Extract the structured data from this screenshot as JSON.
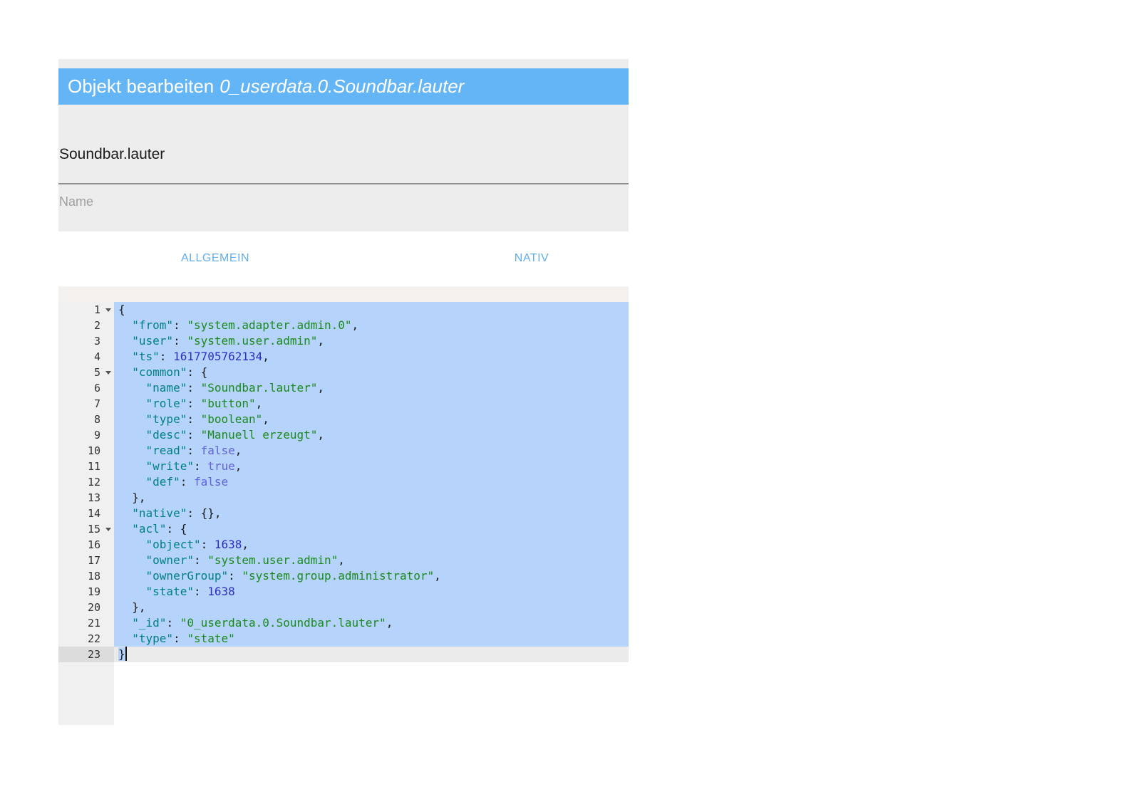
{
  "dialog": {
    "header": {
      "title_prefix": "Objekt bearbeiten",
      "object_id": "0_userdata.0.Soundbar.lauter"
    },
    "id_section": {
      "value": "Soundbar.lauter",
      "name_placeholder": "Name"
    },
    "tabs": [
      {
        "label": "ALLGEMEIN"
      },
      {
        "label": "NATIV"
      }
    ]
  },
  "colors": {
    "header-bg": "#64b5f6",
    "panel-bg": "#ededed",
    "tab-text": "#64aee8",
    "selection": "#b5d3fb",
    "gutter-bg": "#f0f0f0",
    "active-line": "#ebebeb",
    "active-gutter": "#dcdcdc",
    "tok-key": "#008080",
    "tok-string": "#1a8a1a",
    "tok-number": "#2e2ec0",
    "tok-boolean": "#6262d9"
  },
  "editor": {
    "lines": [
      {
        "n": 1,
        "fold": true,
        "sel": true,
        "tokens": [
          [
            "p",
            "{"
          ]
        ]
      },
      {
        "n": 2,
        "sel": true,
        "tokens": [
          [
            "p",
            "  "
          ],
          [
            "k",
            "\"from\""
          ],
          [
            "p",
            ": "
          ],
          [
            "s",
            "\"system.adapter.admin.0\""
          ],
          [
            "p",
            ","
          ]
        ]
      },
      {
        "n": 3,
        "sel": true,
        "tokens": [
          [
            "p",
            "  "
          ],
          [
            "k",
            "\"user\""
          ],
          [
            "p",
            ": "
          ],
          [
            "s",
            "\"system.user.admin\""
          ],
          [
            "p",
            ","
          ]
        ]
      },
      {
        "n": 4,
        "sel": true,
        "tokens": [
          [
            "p",
            "  "
          ],
          [
            "k",
            "\"ts\""
          ],
          [
            "p",
            ": "
          ],
          [
            "n",
            "1617705762134"
          ],
          [
            "p",
            ","
          ]
        ]
      },
      {
        "n": 5,
        "fold": true,
        "sel": true,
        "tokens": [
          [
            "p",
            "  "
          ],
          [
            "k",
            "\"common\""
          ],
          [
            "p",
            ": {"
          ]
        ]
      },
      {
        "n": 6,
        "sel": true,
        "tokens": [
          [
            "p",
            "    "
          ],
          [
            "k",
            "\"name\""
          ],
          [
            "p",
            ": "
          ],
          [
            "s",
            "\"Soundbar.lauter\""
          ],
          [
            "p",
            ","
          ]
        ]
      },
      {
        "n": 7,
        "sel": true,
        "tokens": [
          [
            "p",
            "    "
          ],
          [
            "k",
            "\"role\""
          ],
          [
            "p",
            ": "
          ],
          [
            "s",
            "\"button\""
          ],
          [
            "p",
            ","
          ]
        ]
      },
      {
        "n": 8,
        "sel": true,
        "tokens": [
          [
            "p",
            "    "
          ],
          [
            "k",
            "\"type\""
          ],
          [
            "p",
            ": "
          ],
          [
            "s",
            "\"boolean\""
          ],
          [
            "p",
            ","
          ]
        ]
      },
      {
        "n": 9,
        "sel": true,
        "tokens": [
          [
            "p",
            "    "
          ],
          [
            "k",
            "\"desc\""
          ],
          [
            "p",
            ": "
          ],
          [
            "s",
            "\"Manuell erzeugt\""
          ],
          [
            "p",
            ","
          ]
        ]
      },
      {
        "n": 10,
        "sel": true,
        "tokens": [
          [
            "p",
            "    "
          ],
          [
            "k",
            "\"read\""
          ],
          [
            "p",
            ": "
          ],
          [
            "b",
            "false"
          ],
          [
            "p",
            ","
          ]
        ]
      },
      {
        "n": 11,
        "sel": true,
        "tokens": [
          [
            "p",
            "    "
          ],
          [
            "k",
            "\"write\""
          ],
          [
            "p",
            ": "
          ],
          [
            "b",
            "true"
          ],
          [
            "p",
            ","
          ]
        ]
      },
      {
        "n": 12,
        "sel": true,
        "tokens": [
          [
            "p",
            "    "
          ],
          [
            "k",
            "\"def\""
          ],
          [
            "p",
            ": "
          ],
          [
            "b",
            "false"
          ]
        ]
      },
      {
        "n": 13,
        "sel": true,
        "tokens": [
          [
            "p",
            "  },"
          ]
        ]
      },
      {
        "n": 14,
        "sel": true,
        "tokens": [
          [
            "p",
            "  "
          ],
          [
            "k",
            "\"native\""
          ],
          [
            "p",
            ": {},"
          ]
        ]
      },
      {
        "n": 15,
        "fold": true,
        "sel": true,
        "tokens": [
          [
            "p",
            "  "
          ],
          [
            "k",
            "\"acl\""
          ],
          [
            "p",
            ": {"
          ]
        ]
      },
      {
        "n": 16,
        "sel": true,
        "tokens": [
          [
            "p",
            "    "
          ],
          [
            "k",
            "\"object\""
          ],
          [
            "p",
            ": "
          ],
          [
            "n",
            "1638"
          ],
          [
            "p",
            ","
          ]
        ]
      },
      {
        "n": 17,
        "sel": true,
        "tokens": [
          [
            "p",
            "    "
          ],
          [
            "k",
            "\"owner\""
          ],
          [
            "p",
            ": "
          ],
          [
            "s",
            "\"system.user.admin\""
          ],
          [
            "p",
            ","
          ]
        ]
      },
      {
        "n": 18,
        "sel": true,
        "tokens": [
          [
            "p",
            "    "
          ],
          [
            "k",
            "\"ownerGroup\""
          ],
          [
            "p",
            ": "
          ],
          [
            "s",
            "\"system.group.administrator\""
          ],
          [
            "p",
            ","
          ]
        ]
      },
      {
        "n": 19,
        "sel": true,
        "tokens": [
          [
            "p",
            "    "
          ],
          [
            "k",
            "\"state\""
          ],
          [
            "p",
            ": "
          ],
          [
            "n",
            "1638"
          ]
        ]
      },
      {
        "n": 20,
        "sel": true,
        "tokens": [
          [
            "p",
            "  },"
          ]
        ]
      },
      {
        "n": 21,
        "sel": true,
        "tokens": [
          [
            "p",
            "  "
          ],
          [
            "k",
            "\"_id\""
          ],
          [
            "p",
            ": "
          ],
          [
            "s",
            "\"0_userdata.0.Soundbar.lauter\""
          ],
          [
            "p",
            ","
          ]
        ]
      },
      {
        "n": 22,
        "sel": true,
        "tokens": [
          [
            "p",
            "  "
          ],
          [
            "k",
            "\"type\""
          ],
          [
            "p",
            ": "
          ],
          [
            "s",
            "\"state\""
          ]
        ]
      },
      {
        "n": 23,
        "active": true,
        "cursor": true,
        "tokens": [
          [
            "p",
            "}",
            true
          ]
        ]
      }
    ]
  }
}
